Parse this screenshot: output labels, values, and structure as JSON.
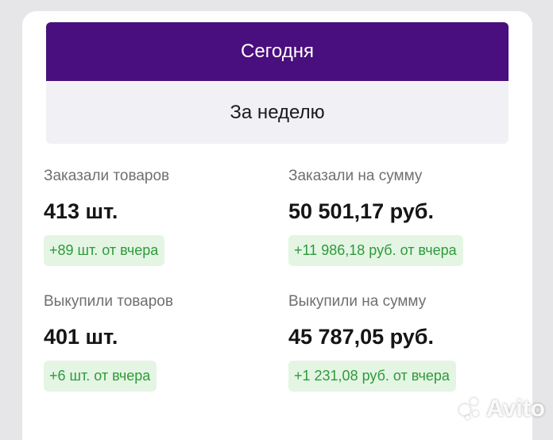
{
  "tabs": {
    "today": "Сегодня",
    "week": "За неделю",
    "active": "today"
  },
  "stats": {
    "ordered_items": {
      "label": "Заказали товаров",
      "value": "413 шт.",
      "delta": "+89 шт. от вчера"
    },
    "ordered_sum": {
      "label": "Заказали на сумму",
      "value": "50 501,17 руб.",
      "delta": "+11 986,18 руб. от вчера"
    },
    "bought_items": {
      "label": "Выкупили товаров",
      "value": "401 шт.",
      "delta": "+6 шт. от вчера"
    },
    "bought_sum": {
      "label": "Выкупили на сумму",
      "value": "45 787,05 руб.",
      "delta": "+1 231,08 руб. от вчера"
    }
  },
  "watermark": {
    "text": "Avito",
    "icon": "avito-logo-icon"
  },
  "colors": {
    "active_tab": "#4a0f7e",
    "inactive_tab": "#f1f0f4",
    "delta_bg": "#e4f5e4",
    "delta_text": "#2e9a3a"
  }
}
